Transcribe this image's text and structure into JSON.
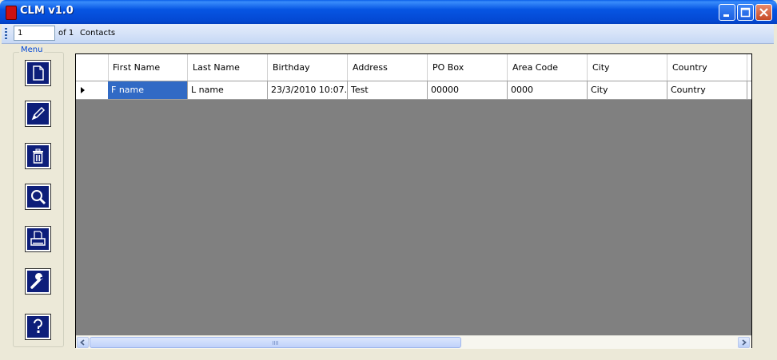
{
  "window": {
    "title": "CLM v1.0",
    "icon": "app-icon",
    "controls": [
      "minimize-icon",
      "maximize-icon",
      "close-icon"
    ]
  },
  "navigator": {
    "position_value": "1",
    "of_label": "of 1",
    "contacts_label": "Contacts"
  },
  "menu": {
    "legend": "Menu",
    "buttons": [
      {
        "name": "new-contact-button",
        "icon": "document-icon"
      },
      {
        "name": "edit-contact-button",
        "icon": "pencil-icon"
      },
      {
        "name": "delete-contact-button",
        "icon": "trash-icon"
      },
      {
        "name": "search-contact-button",
        "icon": "magnifier-icon"
      },
      {
        "name": "print-button",
        "icon": "printer-icon"
      },
      {
        "name": "settings-button",
        "icon": "wrench-icon"
      },
      {
        "name": "help-button",
        "icon": "help-icon"
      }
    ]
  },
  "grid": {
    "columns": [
      "First Name",
      "Last Name",
      "Birthday",
      "Address",
      "PO Box",
      "Area Code",
      "City",
      "Country"
    ],
    "rows": [
      [
        "F name",
        "L name",
        "23/3/2010 10:07...",
        "Test",
        "00000",
        "0000",
        "City",
        "Country"
      ]
    ]
  }
}
